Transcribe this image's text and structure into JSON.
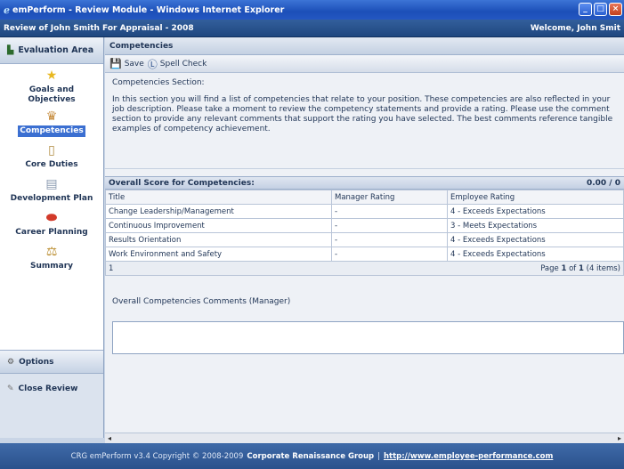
{
  "window": {
    "title": "emPerform - Review Module - Windows Internet Explorer",
    "ie_icon": "ie-logo-icon"
  },
  "app_header": {
    "review_title": "Review of John Smith For Appraisal - 2008",
    "welcome": "Welcome, John Smit"
  },
  "sidebar": {
    "header": "Evaluation Area",
    "items": [
      {
        "label": "Goals and Objectives",
        "icon": "star-icon"
      },
      {
        "label": "Competencies",
        "icon": "trophy-icon"
      },
      {
        "label": "Core Duties",
        "icon": "clipboard-icon"
      },
      {
        "label": "Development Plan",
        "icon": "chart-icon"
      },
      {
        "label": "Career Planning",
        "icon": "pill-icon"
      },
      {
        "label": "Summary",
        "icon": "scales-icon"
      }
    ],
    "options": "Options",
    "close_review": "Close Review"
  },
  "section_title": "Competencies",
  "toolbar": {
    "save": "Save",
    "spell_check": "Spell Check"
  },
  "intro": {
    "heading": "Competencies Section:",
    "body": "In this section you will find a list of competencies that relate to your position. These competencies are also reflected in your job description. Please take a moment to review the competency statements and provide a rating. Please use the comment section to provide any relevant comments that support the rating you have selected. The best comments reference tangible examples of competency achievement."
  },
  "score": {
    "label": "Overall Score for Competencies:",
    "value": "0.00 / 0"
  },
  "table": {
    "columns": [
      "Title",
      "Manager Rating",
      "Employee Rating"
    ],
    "rows": [
      [
        "Change Leadership/Management",
        "-",
        "4 - Exceeds Expectations"
      ],
      [
        "Continuous Improvement",
        "-",
        "3 - Meets Expectations"
      ],
      [
        "Results Orientation",
        "-",
        "4 - Exceeds Expectations"
      ],
      [
        "Work Environment and Safety",
        "-",
        "4 - Exceeds Expectations"
      ]
    ],
    "pager_left": "1",
    "pager_right_prefix": "Page",
    "pager_page": "1",
    "pager_of": "of",
    "pager_total": "1",
    "pager_items": "(4 items)"
  },
  "comments_label": "Overall Competencies Comments (Manager)",
  "footer": {
    "prefix": "CRG emPerform v3.4 Copyright © 2008-2009",
    "company": "Corporate Renaissance Group",
    "separator": "|",
    "url": "http://www.employee-performance.com"
  }
}
